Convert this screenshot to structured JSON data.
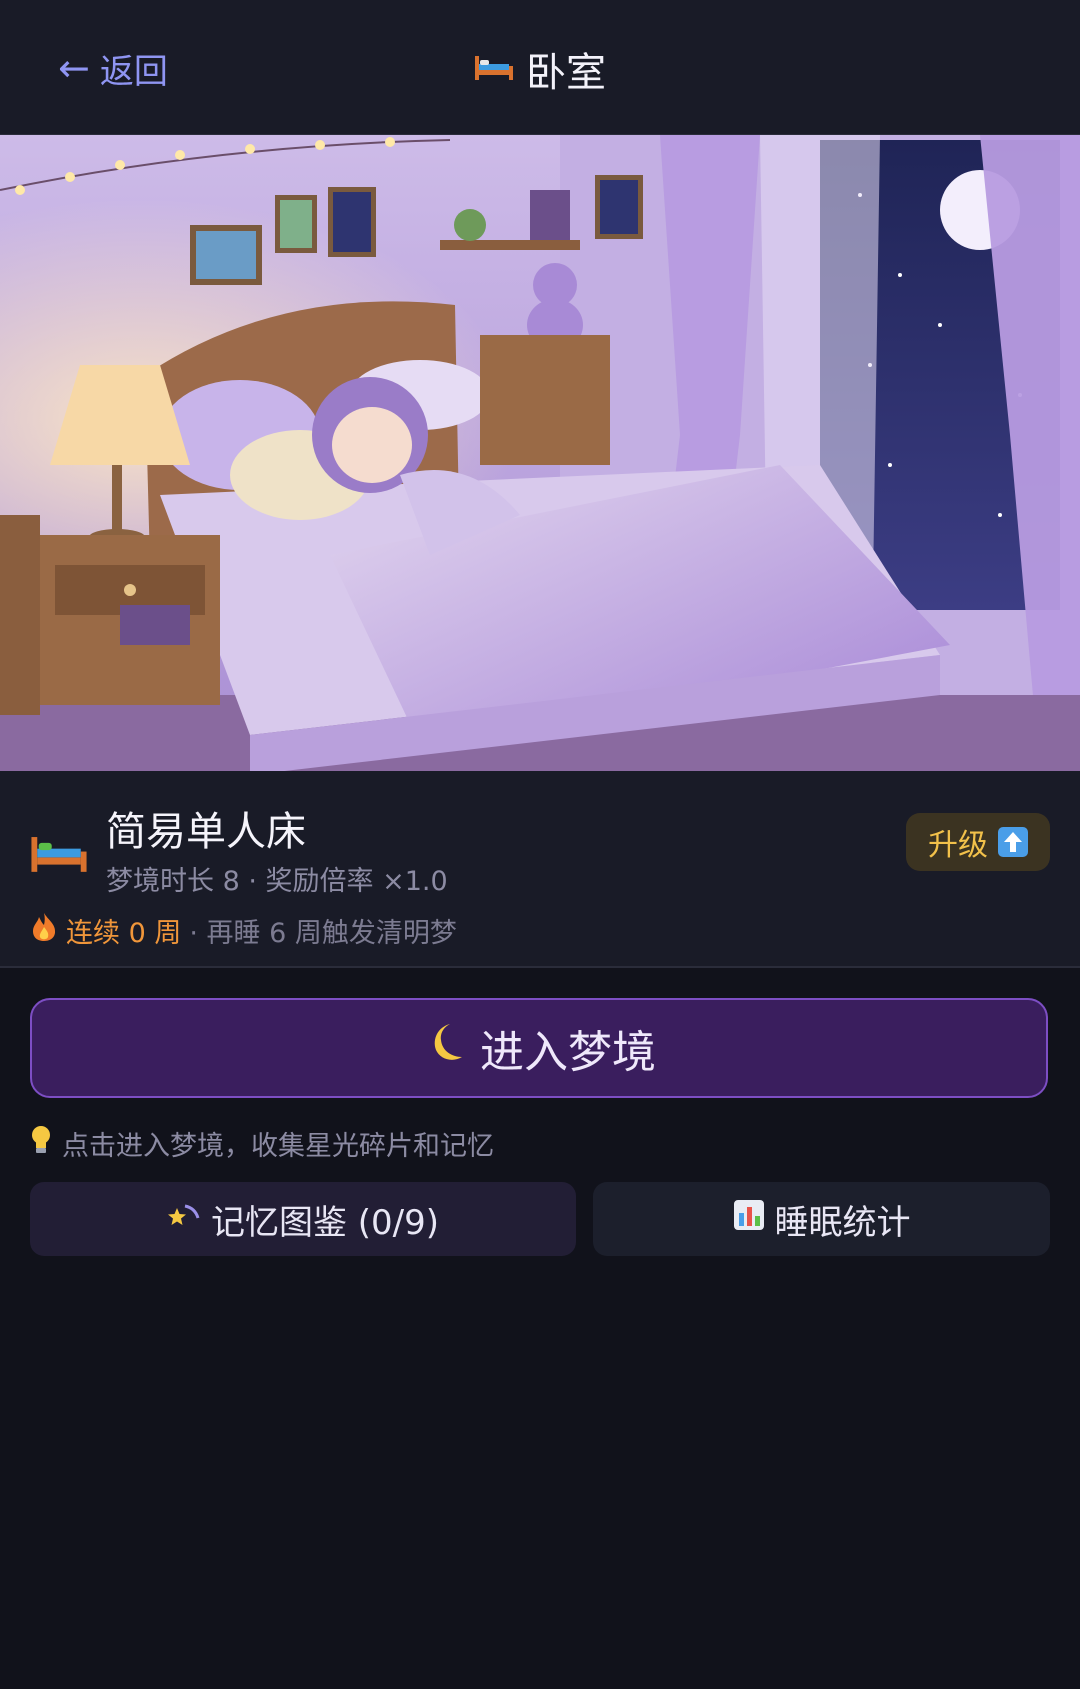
{
  "header": {
    "back_label": "返回",
    "title": "卧室",
    "title_icon": "bed-icon"
  },
  "hero": {
    "alt": "bedroom-illustration"
  },
  "item": {
    "icon": "bed-icon",
    "name": "简易单人床",
    "stats": "梦境时长 8 · 奖励倍率 ×1.0",
    "streak_label": "连续 0 周",
    "streak_hint": "· 再睡 6 周触发清明梦",
    "upgrade_label": "升级"
  },
  "actions": {
    "enter_label": "进入梦境",
    "tip": "点击进入梦境，收集星光碎片和记忆",
    "memory_label": "记忆图鉴 (0/9)",
    "stats_label": "睡眠统计"
  },
  "colors": {
    "accent": "#8f95f2",
    "enter_bg": "#3a1e5e",
    "enter_border": "#7d4ec4",
    "streak": "#f0963a",
    "upgrade": "#f2c14a"
  }
}
